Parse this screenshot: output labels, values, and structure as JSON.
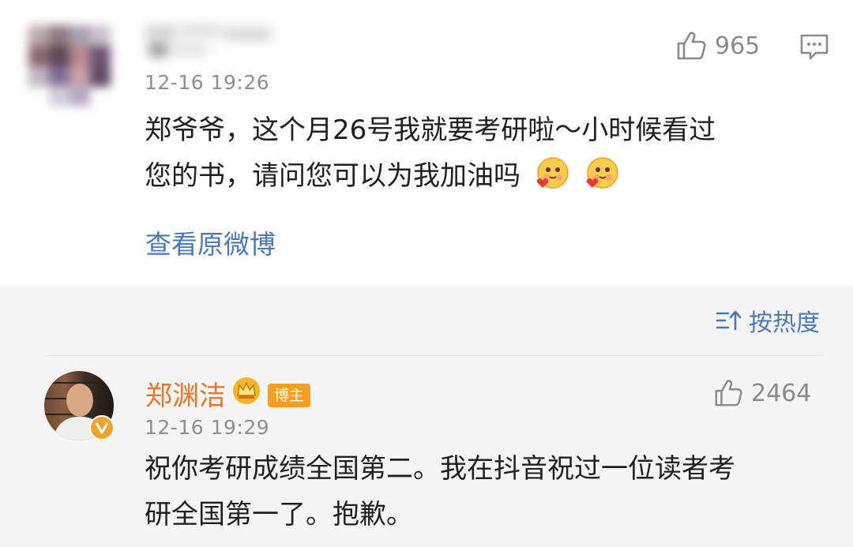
{
  "comment": {
    "timestamp": "12-16 19:26",
    "likes": "965",
    "text_line1": "郑爷爷，这个月26号我就要考研啦～小时候看过",
    "text_line2": "您的书，请问您可以为我加油吗",
    "view_original": "查看原微博"
  },
  "replies_header": {
    "sort_label": "按热度"
  },
  "reply": {
    "author": "郑渊洁",
    "badge": "博主",
    "timestamp": "12-16 19:29",
    "likes": "2464",
    "text_line1": "祝你考研成绩全国第二。我在抖音祝过一位读者考",
    "text_line2": "研全国第一了。抱歉。"
  },
  "colors": {
    "link": "#4a79b4",
    "author_name": "#e8762c",
    "badge_bg": "#f5a020",
    "meta_gray": "#8f8f8f",
    "reply_bg": "#f5f5f5"
  },
  "icons": [
    "thumbs-up-icon",
    "comment-icon",
    "sort-icon",
    "crown-icon",
    "verified-v-icon",
    "blush-hug-emoji"
  ]
}
